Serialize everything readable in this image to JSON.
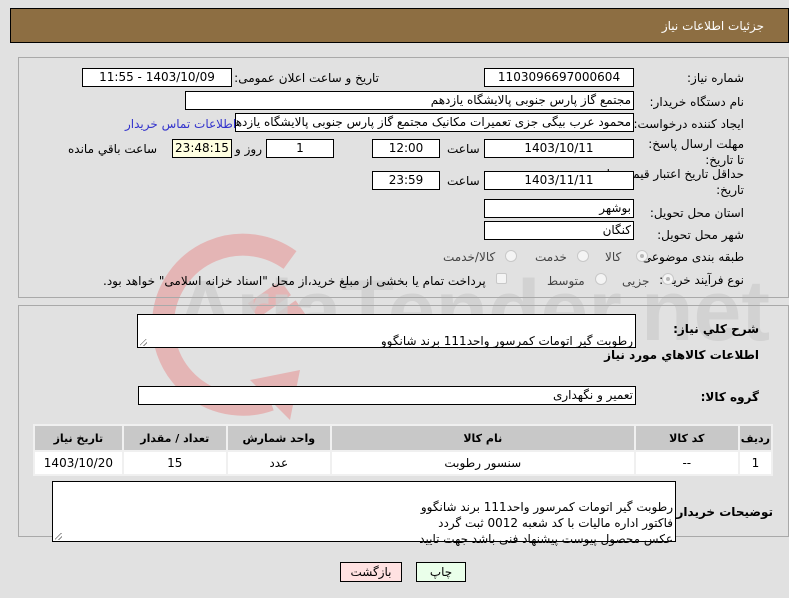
{
  "header": {
    "title": "جزئیات اطلاعات نیاز"
  },
  "form": {
    "need_number_label": "شماره نیاز:",
    "need_number": "1103096697000604",
    "announce_label": "تاریخ و ساعت اعلان عمومی:",
    "announce_value": "1403/10/09 - 11:55",
    "buyer_org_label": "نام دستگاه خریدار:",
    "buyer_org": "مجتمع گاز پارس جنوبی  پالایشگاه یازدهم",
    "creator_label": "ایجاد کننده درخواست:",
    "creator": "محمود عرب بیگی جزی تعمیرات مکانیک مجتمع گاز پارس جنوبی  پالایشگاه یازدهم",
    "buyer_contact_link": "اطلاعات تماس خریدار",
    "reply_deadline_label": "مهلت ارسال پاسخ: تا تاریخ:",
    "reply_date": "1403/10/11",
    "time_label": "ساعت",
    "reply_time": "12:00",
    "days_value": "1",
    "days_label": "روز و",
    "remaining_time": "23:48:15",
    "remaining_label": "ساعت باقي مانده",
    "price_validity_label": "حداقل تاریخ اعتبار قیمت: تا تاریخ:",
    "price_date": "1403/11/11",
    "price_time": "23:59",
    "province_label": "استان محل تحویل:",
    "province": "بوشهر",
    "city_label": "شهر محل تحویل:",
    "city": "کنگان",
    "category_label": "طبقه بندی موضوعی:",
    "category_options": [
      "کالا",
      "خدمت",
      "کالا/خدمت"
    ],
    "category_selected": "کالا",
    "purchase_type_label": "نوع فرآیند خرید :",
    "purchase_options": [
      "جزیی",
      "متوسط"
    ],
    "purchase_selected": "جزیی",
    "treasury_note": "پرداخت تمام یا بخشی از مبلغ خرید،از محل \"اسناد خزانه اسلامی\" خواهد بود."
  },
  "details": {
    "summary_label": "شرح کلي نياز:",
    "summary": "رطوبت گیر اتومات کمرسور واحد111  برند شانگوو",
    "items_heading": "اطلاعات کالاهاي مورد نياز",
    "group_label": "گروه کالا:",
    "group": "تعمیر و نگهداری",
    "table": {
      "headers": [
        "ردیف",
        "کد کالا",
        "نام کالا",
        "واحد شمارش",
        "تعداد / مقدار",
        "تاریخ نیاز"
      ],
      "rows": [
        [
          "1",
          "--",
          "سنسور رطوبت",
          "عدد",
          "15",
          "1403/10/20"
        ]
      ]
    },
    "buyer_notes_label": "توضیحات خریدار:",
    "buyer_notes": "رطوبت گیر اتومات کمرسور واحد111  برند شانگوو\nفاکتور اداره مالیات با کد شعبه 0012 ثبت گردد\nعکس محصول پیوست پیشنهاد فنی باشد جهت تایید"
  },
  "buttons": {
    "print": "چاپ",
    "back": "بازگشت"
  },
  "watermark": {
    "text": "AriaTender.net"
  },
  "colors": {
    "header_bg": "#8d6e42",
    "print_bg": "#eaffea",
    "back_bg": "#ffe1e1",
    "link": "#3333cc"
  }
}
